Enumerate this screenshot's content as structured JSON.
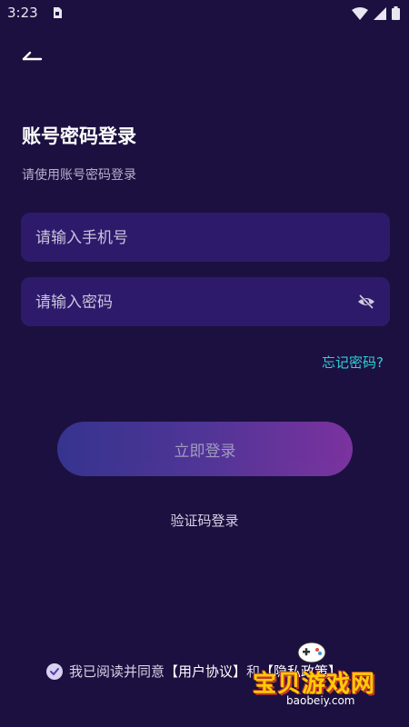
{
  "status_bar": {
    "time": "3:23"
  },
  "header": {
    "title": "账号密码登录",
    "subtitle": "请使用账号密码登录"
  },
  "form": {
    "phone_placeholder": "请输入手机号",
    "password_placeholder": "请输入密码",
    "forgot_label": "忘记密码?",
    "login_label": "立即登录",
    "sms_login_label": "验证码登录"
  },
  "agreement": {
    "prefix": "我已阅读并同意",
    "user_agreement": "【用户协议】",
    "joiner": "和",
    "privacy_policy": "【隐私政策】"
  },
  "watermark": {
    "name": "宝贝游戏网",
    "url": "baobeiy.com"
  },
  "colors": {
    "background": "#1c1040",
    "field": "#2e1a6b",
    "accent": "#2fd0d6",
    "button_start": "#3a3a9c",
    "button_end": "#8c39b0"
  }
}
